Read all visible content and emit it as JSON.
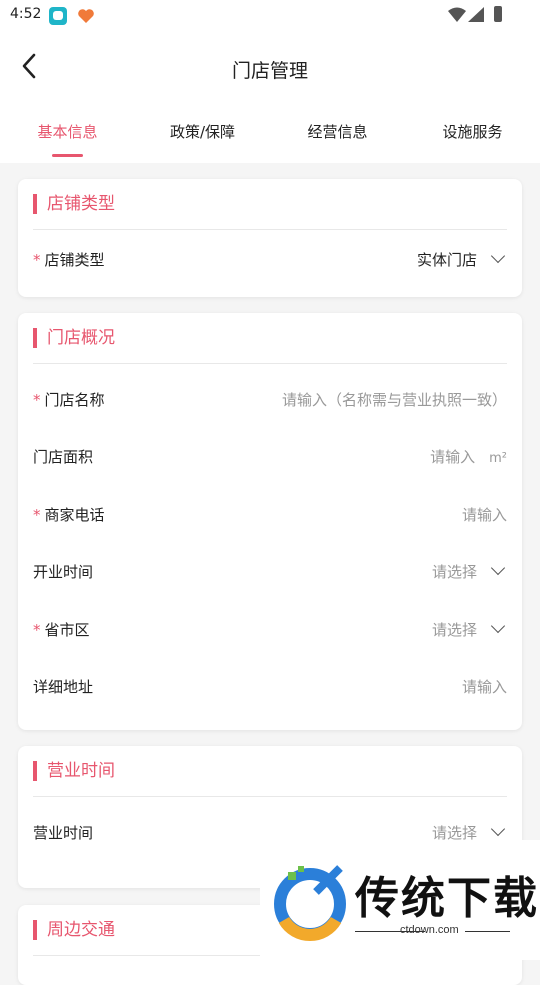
{
  "status_bar": {
    "time": "4:52"
  },
  "header": {
    "title": "门店管理"
  },
  "tabs": [
    {
      "label": "基本信息",
      "active": true
    },
    {
      "label": "政策/保障",
      "active": false
    },
    {
      "label": "经营信息",
      "active": false
    },
    {
      "label": "设施服务",
      "active": false
    }
  ],
  "sections": {
    "store_type": {
      "title": "店铺类型",
      "field_label": "店铺类型",
      "field_value": "实体门店"
    },
    "overview": {
      "title": "门店概况",
      "store_name_label": "门店名称",
      "store_name_placeholder": "请输入（名称需与营业执照一致）",
      "area_label": "门店面积",
      "area_placeholder": "请输入",
      "area_unit": "m²",
      "phone_label": "商家电话",
      "phone_placeholder": "请输入",
      "open_time_label": "开业时间",
      "open_time_placeholder": "请选择",
      "region_label": "省市区",
      "region_placeholder": "请选择",
      "address_label": "详细地址",
      "address_placeholder": "请输入"
    },
    "business_hours": {
      "title": "营业时间",
      "field_label": "营业时间",
      "field_placeholder": "请选择"
    },
    "transport": {
      "title": "周边交通"
    }
  },
  "required_mark": "*",
  "watermark": {
    "title": "传统下载",
    "domain": "ctdown.com"
  },
  "colors": {
    "accent": "#e7566e",
    "placeholder": "#999999"
  }
}
